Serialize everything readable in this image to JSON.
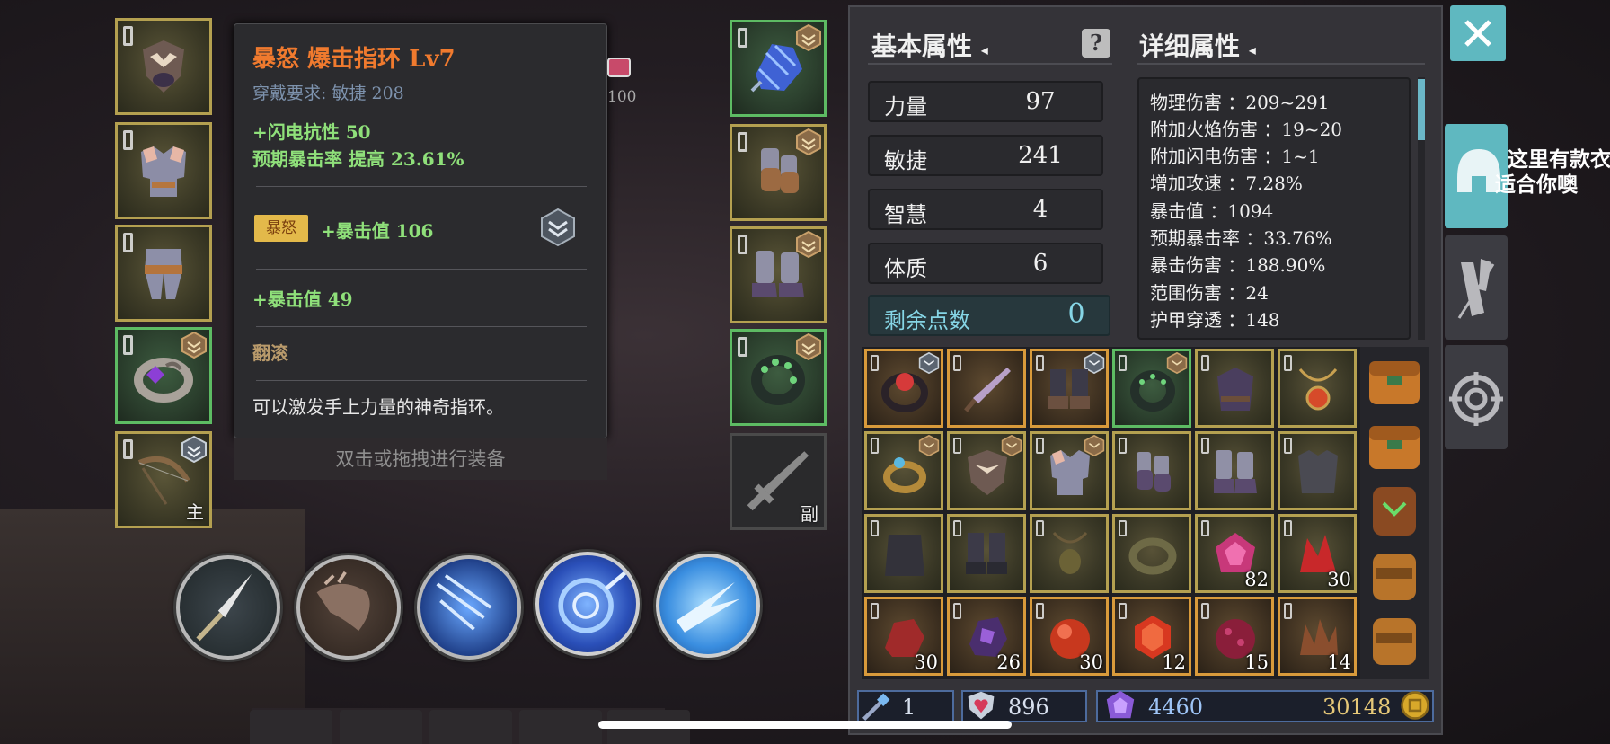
{
  "tooltip": {
    "title": "暴怒  爆击指环  Lv7",
    "requirement": "穿戴要求:    敏捷  208",
    "stat1": "+闪电抗性  50",
    "stat2": "预期暴击率  提高  23.61%",
    "rage_badge": "暴怒",
    "rage_stat": "+暴击值  106",
    "extra_stat": "+暴击值  49",
    "skill_name": "翻滚",
    "description": "可以激发手上力量的神奇指环。",
    "hint": "双击或拖拽进行装备"
  },
  "hud_peek": {
    "fragment": "100"
  },
  "equip_left": [
    {
      "name": "hood",
      "hand": ""
    },
    {
      "name": "chest-armor",
      "hand": ""
    },
    {
      "name": "leg-armor",
      "hand": ""
    },
    {
      "name": "ring",
      "hand": ""
    },
    {
      "name": "bow",
      "hand": "主"
    }
  ],
  "equip_right": [
    {
      "name": "shard-amulet",
      "hand": ""
    },
    {
      "name": "gloves",
      "hand": ""
    },
    {
      "name": "boots",
      "hand": ""
    },
    {
      "name": "green-ring",
      "hand": ""
    },
    {
      "name": "sword-placeholder",
      "hand": "副"
    }
  ],
  "stats": {
    "basic_header": "基本属性",
    "detail_header": "详细属性",
    "strength_label": "力量",
    "strength_value": "97",
    "agility_label": "敏捷",
    "agility_value": "241",
    "wisdom_label": "智慧",
    "wisdom_value": "4",
    "constitution_label": "体质",
    "constitution_value": "6",
    "remaining_label": "剩余点数",
    "remaining_value": "0"
  },
  "details": [
    "物理伤害 ：209~291",
    "附加火焰伤害 ：19~20",
    "附加闪电伤害 ：1~1",
    "增加攻速 ：7.28%",
    "暴击值 ：1094",
    "预期暴击率 ：33.76%",
    "暴击伤害 ：188.90%",
    "范围伤害 ：24",
    "护甲穿透 ：148"
  ],
  "inventory_counts": {
    "r2c4": "82",
    "r2c5": "30",
    "r3c0": "30",
    "r3c1": "26",
    "r3c2": "30",
    "r3c3": "12",
    "r3c4": "15",
    "r3c5": "14"
  },
  "currency": {
    "keys": "1",
    "hearts": "896",
    "gems": "4460",
    "gold": "30148"
  },
  "promo": {
    "line1": "这里有款衣",
    "line2": "适合你噢"
  },
  "colors": {
    "accent": "#5fb8c0",
    "rare_border": "#b4a050",
    "epic_border": "#d89a3b",
    "uncommon_border": "#5dbb63",
    "tooltip_title": "#f07a2e"
  }
}
